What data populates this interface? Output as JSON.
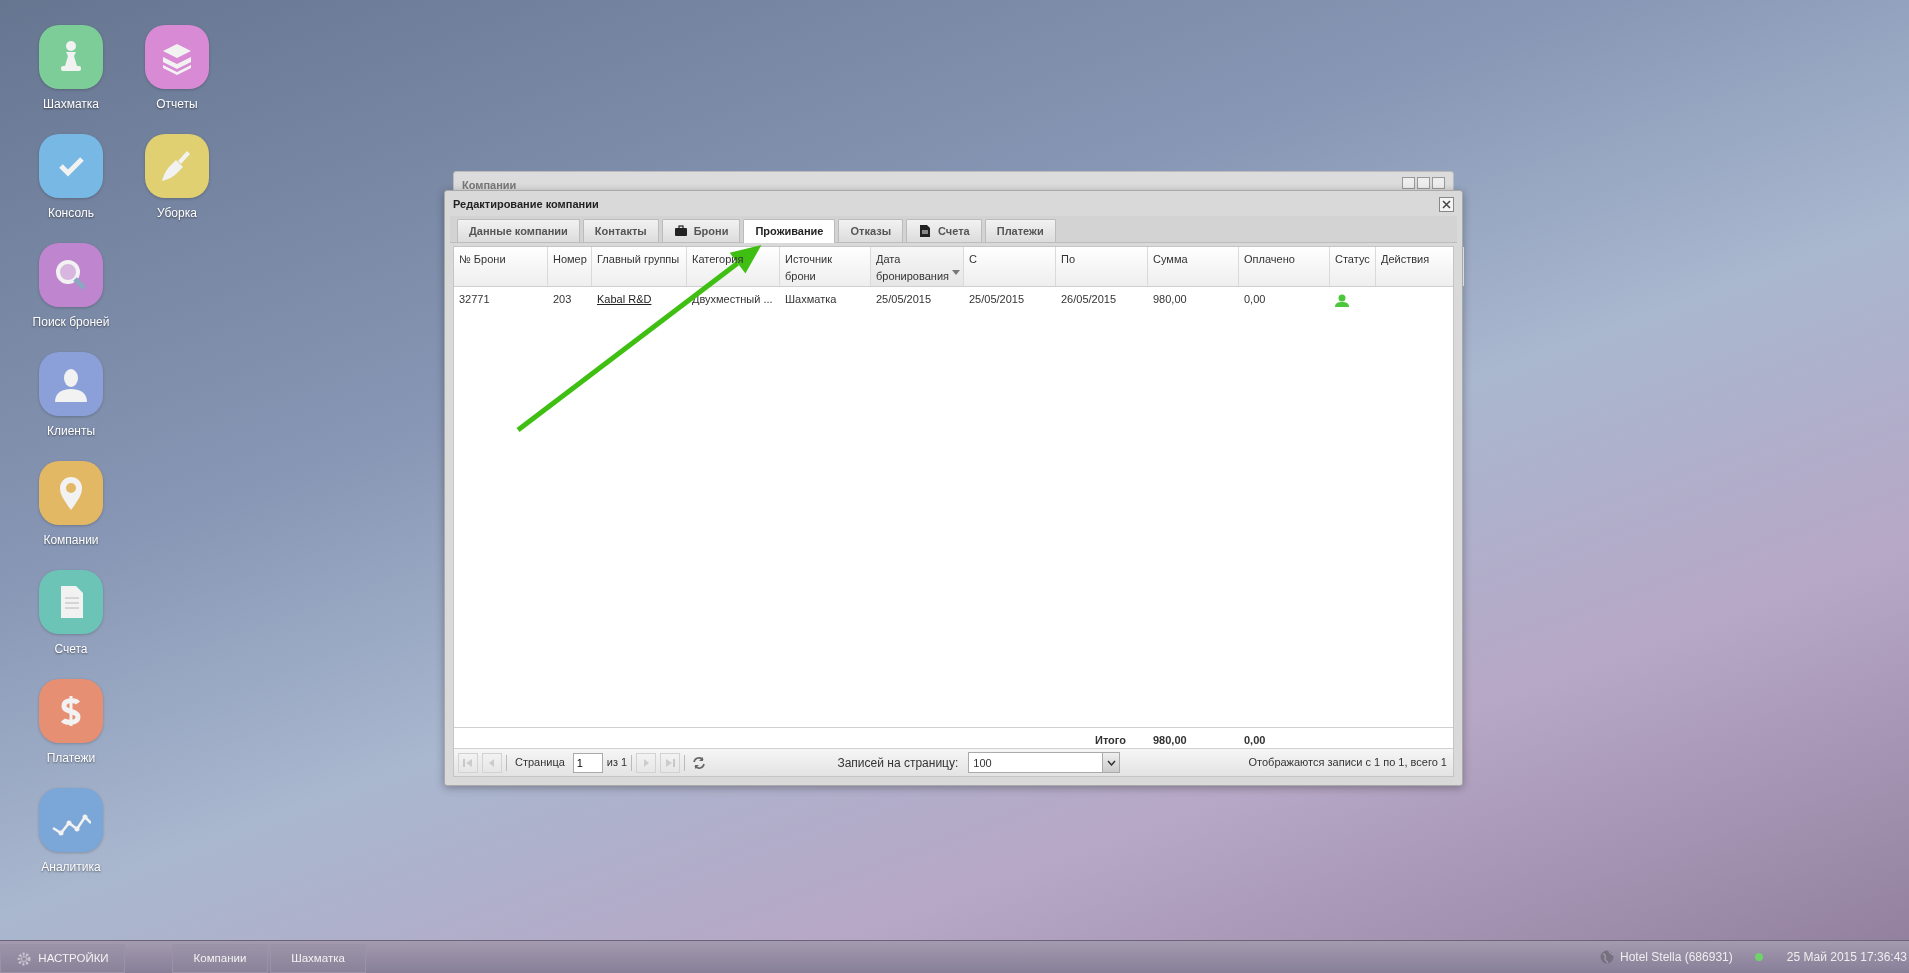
{
  "desktop": {
    "columns": [
      [
        {
          "label": "Шахматка",
          "kind": "pawn"
        },
        {
          "label": "Консоль",
          "kind": "check"
        },
        {
          "label": "Поиск броней",
          "kind": "search"
        },
        {
          "label": "Клиенты",
          "kind": "person"
        },
        {
          "label": "Компании",
          "kind": "pin"
        },
        {
          "label": "Счета",
          "kind": "document"
        },
        {
          "label": "Платежи",
          "kind": "dollar"
        },
        {
          "label": "Аналитика",
          "kind": "chart"
        }
      ],
      [
        {
          "label": "Отчеты",
          "kind": "books"
        },
        {
          "label": "Уборка",
          "kind": "broom"
        }
      ]
    ]
  },
  "background_window": {
    "title": "Компании"
  },
  "dialog": {
    "title": "Редактирование компании",
    "tabs": [
      {
        "label": "Данные компании",
        "kind": "plain",
        "selected": false
      },
      {
        "label": "Контакты",
        "kind": "plain",
        "selected": false
      },
      {
        "label": "Брони",
        "kind": "icon",
        "selected": false
      },
      {
        "label": "Проживание",
        "kind": "plain",
        "selected": true
      },
      {
        "label": "Отказы",
        "kind": "plain",
        "selected": false
      },
      {
        "label": "Счета",
        "kind": "icon",
        "selected": false
      },
      {
        "label": "Платежи",
        "kind": "plain",
        "selected": false
      }
    ],
    "table": {
      "columns": [
        {
          "label": "№ Брони",
          "sorted": false
        },
        {
          "label": "Номер",
          "sorted": false
        },
        {
          "label": "Главный группы",
          "sorted": false
        },
        {
          "label": "Категория",
          "sorted": false
        },
        {
          "label": "Источник брони",
          "sorted": false
        },
        {
          "label": "Дата бронирования",
          "sorted": true
        },
        {
          "label": "С",
          "sorted": false
        },
        {
          "label": "По",
          "sorted": false
        },
        {
          "label": "Сумма",
          "sorted": false
        },
        {
          "label": "Оплачено",
          "sorted": false
        },
        {
          "label": "Статус",
          "sorted": false
        },
        {
          "label": "Действия",
          "sorted": false
        }
      ],
      "rows": [
        {
          "cells": [
            {
              "text": "32771",
              "link": false
            },
            {
              "text": "203",
              "link": false
            },
            {
              "text": "Kabal R&D",
              "link": true
            },
            {
              "text": "Двухместный ...",
              "link": false
            },
            {
              "text": "Шахматка",
              "link": false
            },
            {
              "text": "25/05/2015",
              "link": false
            },
            {
              "text": "25/05/2015",
              "link": false
            },
            {
              "text": "26/05/2015",
              "link": false
            },
            {
              "text": "980,00",
              "link": false
            },
            {
              "text": "0,00",
              "link": false
            }
          ]
        }
      ],
      "totals": {
        "label": "Итого",
        "sum": "980,00",
        "paid": "0,00"
      }
    },
    "pager": {
      "page_label": "Страница",
      "page": "1",
      "of": "из 1",
      "per_page_label": "Записей на страницу:",
      "per_page": "100",
      "summary": "Отображаются записи с 1 по 1, всего 1"
    }
  },
  "annotation": {
    "kind": "arrow",
    "color": "#3fbf12"
  },
  "taskbar": {
    "start": "НАСТРОЙКИ",
    "tasks": [
      "Компании",
      "Шахматка"
    ],
    "hotel": "Hotel Stella (686931)",
    "clock": "25 Май 2015 17:36:43"
  }
}
